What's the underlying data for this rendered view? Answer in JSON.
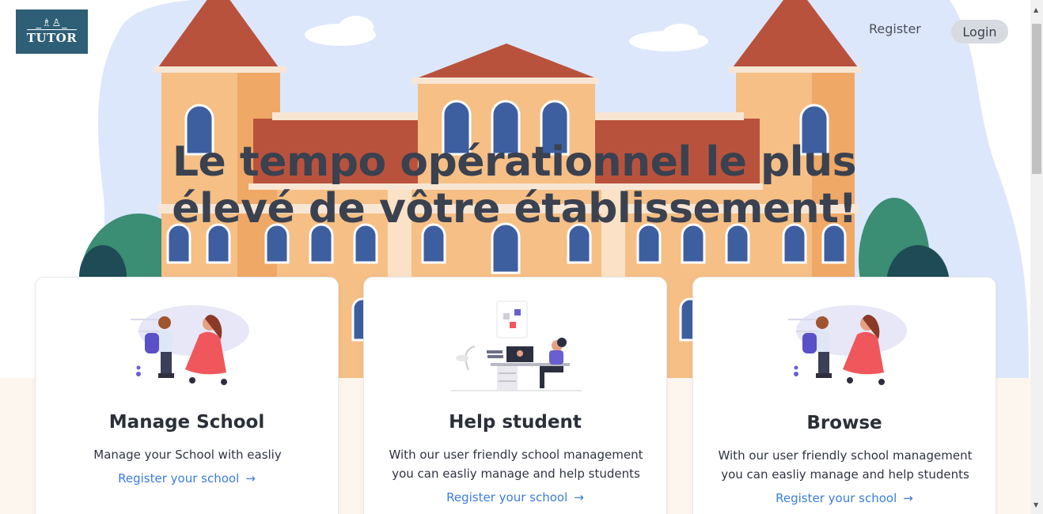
{
  "brand": {
    "logo_text": "TUTOR",
    "logo_icon": "school-children-icon"
  },
  "nav": {
    "register": "Register",
    "login": "Login"
  },
  "hero": {
    "headline": "Le tempo opérationnel le plus élevé de vôtre établissement!"
  },
  "cards": [
    {
      "title": "Manage School",
      "text": "Manage your School with easliy",
      "link": "Register your school",
      "icon": "mother-child-illustration"
    },
    {
      "title": "Help student",
      "text": "With our user friendly school management you can easliy manage and help students",
      "link": "Register your school",
      "icon": "online-learning-illustration"
    },
    {
      "title": "Browse",
      "text": "With our user friendly school management you can easliy manage and help students",
      "link": "Register your school",
      "icon": "mother-child-illustration"
    }
  ],
  "link_arrow": "→",
  "colors": {
    "brand": "#2f5e77",
    "link": "#3b7de0",
    "building": "#f6bf85",
    "roof": "#b9523c",
    "sky": "#dde7fb"
  }
}
